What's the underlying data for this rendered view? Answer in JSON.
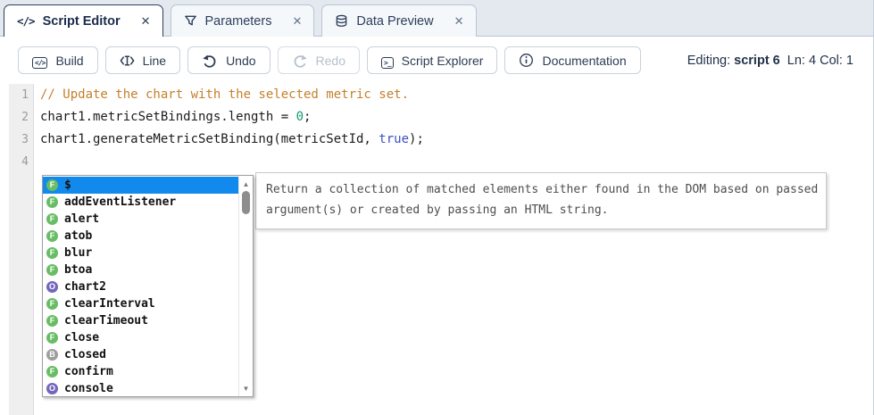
{
  "tabs": [
    {
      "label": "Script Editor",
      "icon": "code-icon",
      "active": true
    },
    {
      "label": "Parameters",
      "icon": "filter-icon",
      "active": false
    },
    {
      "label": "Data Preview",
      "icon": "database-icon",
      "active": false
    }
  ],
  "toolbar": {
    "buttons": [
      {
        "label": "Build",
        "icon": "build-icon",
        "disabled": false
      },
      {
        "label": "Line",
        "icon": "line-icon",
        "disabled": false
      },
      {
        "label": "Undo",
        "icon": "undo-icon",
        "disabled": false
      },
      {
        "label": "Redo",
        "icon": "redo-icon",
        "disabled": true
      },
      {
        "label": "Script Explorer",
        "icon": "script-explorer-icon",
        "disabled": false
      },
      {
        "label": "Documentation",
        "icon": "documentation-icon",
        "disabled": false
      }
    ],
    "status": {
      "editing_label": "Editing: ",
      "editing_value": "script 6",
      "line_label": "  Ln: ",
      "line_value": "4",
      "col_label": " Col: ",
      "col_value": "1"
    }
  },
  "editor": {
    "colors": {
      "comment": "#c5802b",
      "number": "#109a72",
      "keyword": "#3c4ec5",
      "plain": "#1c1c1c"
    },
    "lines": [
      {
        "number": "1",
        "tokens": [
          {
            "text": "// Update the chart with the selected metric set.",
            "type": "comment"
          }
        ]
      },
      {
        "number": "2",
        "tokens": [
          {
            "text": "chart1.metricSetBindings.length = ",
            "type": "plain"
          },
          {
            "text": "0",
            "type": "number"
          },
          {
            "text": ";",
            "type": "plain"
          }
        ]
      },
      {
        "number": "3",
        "tokens": [
          {
            "text": "chart1.generateMetricSetBinding(metricSetId, ",
            "type": "plain"
          },
          {
            "text": "true",
            "type": "keyword"
          },
          {
            "text": ");",
            "type": "plain"
          }
        ]
      },
      {
        "number": "4",
        "tokens": []
      }
    ]
  },
  "autocomplete": {
    "selected_bg": "#1289ec",
    "kind_colors": {
      "F": "#68bd64",
      "O": "#7366bd",
      "B": "#9d9d9d"
    },
    "items": [
      {
        "label": "$",
        "kind": "F",
        "selected": true
      },
      {
        "label": "addEventListener",
        "kind": "F",
        "selected": false
      },
      {
        "label": "alert",
        "kind": "F",
        "selected": false
      },
      {
        "label": "atob",
        "kind": "F",
        "selected": false
      },
      {
        "label": "blur",
        "kind": "F",
        "selected": false
      },
      {
        "label": "btoa",
        "kind": "F",
        "selected": false
      },
      {
        "label": "chart2",
        "kind": "O",
        "selected": false
      },
      {
        "label": "clearInterval",
        "kind": "F",
        "selected": false
      },
      {
        "label": "clearTimeout",
        "kind": "F",
        "selected": false
      },
      {
        "label": "close",
        "kind": "F",
        "selected": false
      },
      {
        "label": "closed",
        "kind": "B",
        "selected": false
      },
      {
        "label": "confirm",
        "kind": "F",
        "selected": false
      },
      {
        "label": "console",
        "kind": "O",
        "selected": false
      }
    ]
  },
  "tooltip": {
    "lines": [
      "Return a collection of matched elements either found in the DOM based on passed",
      "argument(s) or created by passing an HTML string."
    ]
  }
}
